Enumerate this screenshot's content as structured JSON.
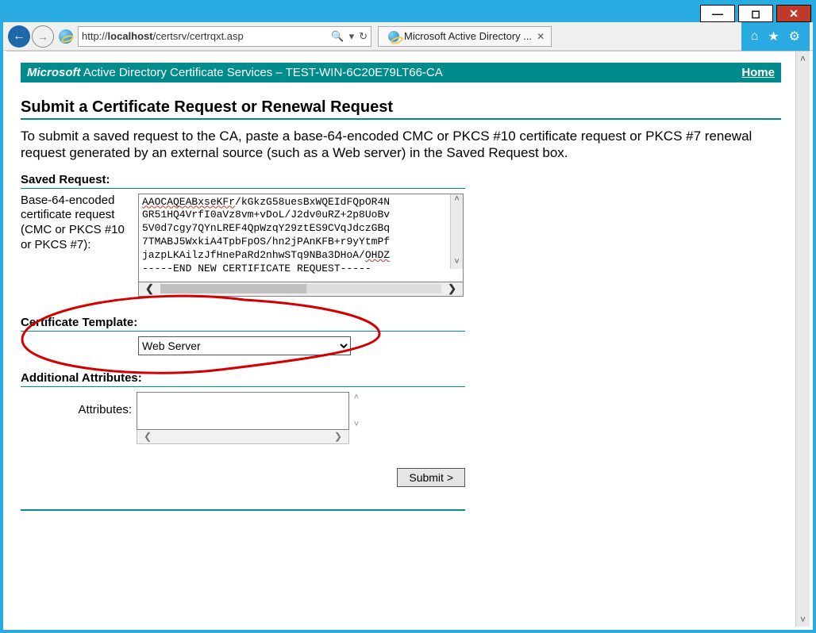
{
  "window": {
    "minimize_glyph": "—",
    "maximize_glyph": "◻",
    "close_glyph": "✕"
  },
  "browser": {
    "back_glyph": "←",
    "forward_glyph": "→",
    "url_prefix": "http://",
    "url_host": "localhost",
    "url_path": "/certsrv/certrqxt.asp",
    "search_glyph": "🔍",
    "dropdown_glyph": "▾",
    "refresh_glyph": "↻",
    "tab_title": "Microsoft Active Directory ...",
    "tab_close": "✕",
    "home_glyph": "⌂",
    "fav_glyph": "★",
    "gear_glyph": "⚙"
  },
  "header": {
    "brand_italic": "Microsoft",
    "brand_rest": " Active Directory Certificate Services  –  TEST-WIN-6C20E79LT66-CA",
    "home_link": "Home"
  },
  "page": {
    "title": "Submit a Certificate Request or Renewal Request",
    "intro": "To submit a saved request to the CA, paste a base-64-encoded CMC or PKCS #10 certificate request or PKCS #7 renewal request generated by an external source (such as a Web server) in the Saved Request box."
  },
  "saved_request": {
    "section_label": "Saved Request:",
    "field_label": "Base-64-encoded certificate request (CMC or PKCS #10 or PKCS #7):",
    "line1_a": "AAOCAQEABxseKFr",
    "line1_b": "/kGkzG58uesBxWQEIdFQpOR4N",
    "line2": "GR51HQ4VrfI0aVz8vm+vDoL/J2dv0uRZ+2p8UoBv",
    "line3": "5V0d7cgy7QYnLREF4QpWzqY29ztES9CVqJdczGBq",
    "line4": "7TMABJ5WxkiA4TpbFpOS/hn2jPAnKFB+r9yYtmPf",
    "line5_a": "jazpLKAilzJfHnePaRd2nhwSTq9NBa3DHoA/",
    "line5_b": "OHDZ",
    "line6": "-----END NEW CERTIFICATE REQUEST-----",
    "scroll_up": "˄",
    "scroll_down": "˅",
    "scroll_left": "❮",
    "scroll_right": "❯"
  },
  "cert_template": {
    "section_label": "Certificate Template:",
    "selected": "Web Server"
  },
  "additional_attributes": {
    "section_label": "Additional Attributes:",
    "field_label": "Attributes:",
    "value": ""
  },
  "submit": {
    "label": "Submit >"
  },
  "viewport_scroll": {
    "up": "˄",
    "down": "˅"
  }
}
